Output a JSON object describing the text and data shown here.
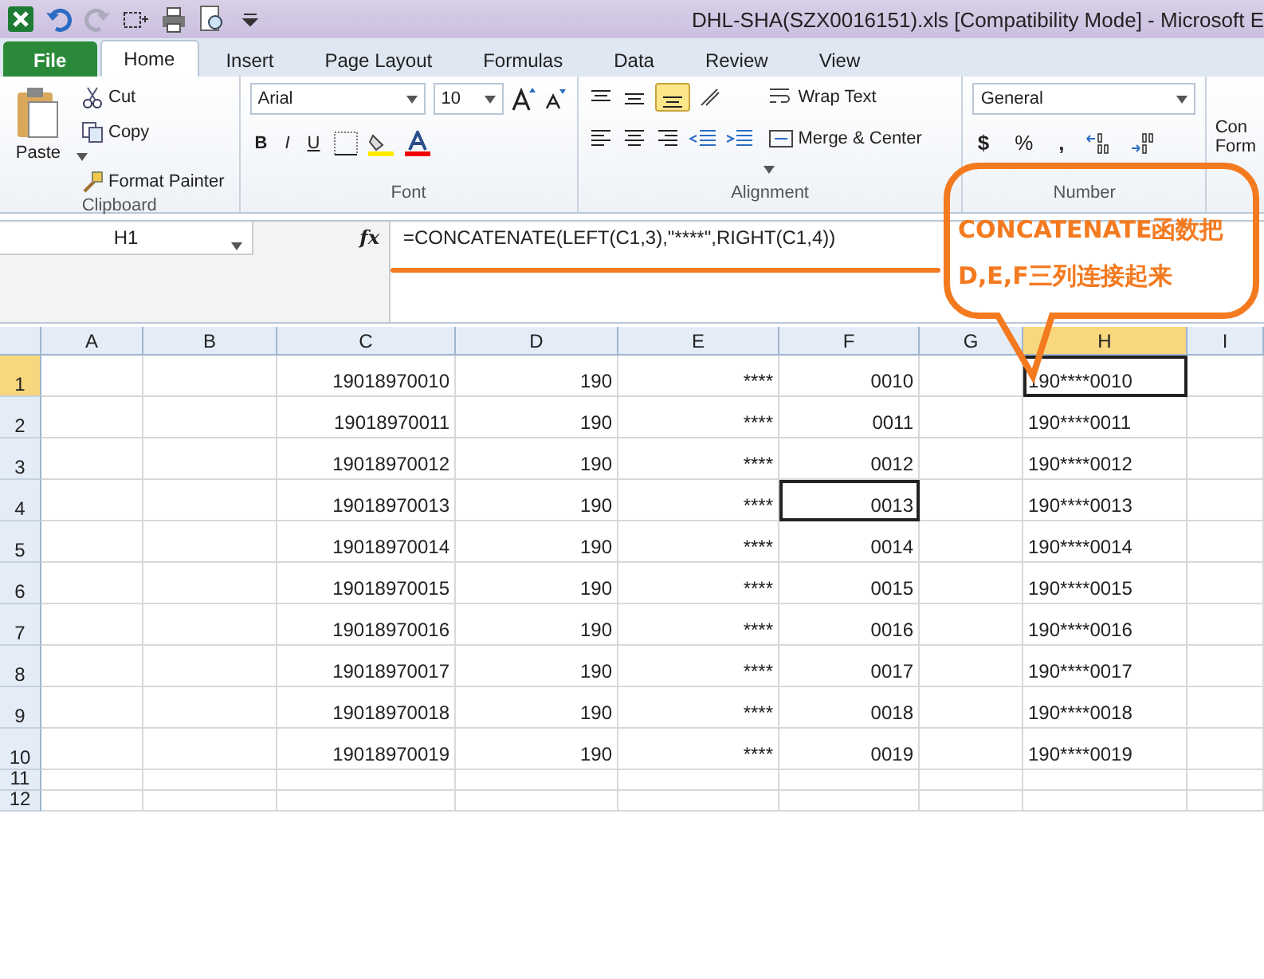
{
  "window": {
    "title": "DHL-SHA(SZX0016151).xls  [Compatibility Mode]  -  Microsoft E"
  },
  "tabs": [
    {
      "label": "File",
      "kind": "file",
      "selected": false
    },
    {
      "label": "Home",
      "kind": "tab",
      "selected": true
    },
    {
      "label": "Insert",
      "kind": "tab",
      "selected": false
    },
    {
      "label": "Page Layout",
      "kind": "tab",
      "selected": false
    },
    {
      "label": "Formulas",
      "kind": "tab",
      "selected": false
    },
    {
      "label": "Data",
      "kind": "tab",
      "selected": false
    },
    {
      "label": "Review",
      "kind": "tab",
      "selected": false
    },
    {
      "label": "View",
      "kind": "tab",
      "selected": false
    }
  ],
  "ribbon": {
    "clipboard": {
      "label": "Clipboard",
      "paste": "Paste",
      "cut": "Cut",
      "copy": "Copy",
      "format_painter": "Format Painter"
    },
    "font": {
      "label": "Font",
      "font_name": "Arial",
      "font_size": "10",
      "bold": "B",
      "italic": "I",
      "underline": "U"
    },
    "alignment": {
      "label": "Alignment",
      "wrap_text": "Wrap Text",
      "merge_center": "Merge & Center",
      "middle_align_on": true
    },
    "number": {
      "label": "Number",
      "format": "General",
      "currency": "$",
      "percent": "%",
      "comma": ","
    },
    "styles": {
      "conditional_formatting": "Con\nForm"
    }
  },
  "name_box": "H1",
  "fx": "fx",
  "formula": "=CONCATENATE(LEFT(C1,3),\"****\",RIGHT(C1,4))",
  "columns": [
    {
      "label": "A",
      "selected": false
    },
    {
      "label": "B",
      "selected": false
    },
    {
      "label": "C",
      "selected": false
    },
    {
      "label": "D",
      "selected": false
    },
    {
      "label": "E",
      "selected": false
    },
    {
      "label": "F",
      "selected": false
    },
    {
      "label": "G",
      "selected": false
    },
    {
      "label": "H",
      "selected": true
    },
    {
      "label": "I",
      "selected": false
    }
  ],
  "rows": [
    {
      "label": "1",
      "selected": true,
      "cells": [
        {},
        {},
        {
          "text": "19018970010",
          "kind": "number"
        },
        {
          "text": "190",
          "kind": "number"
        },
        {
          "text": "****",
          "kind": "number"
        },
        {
          "text": "0010",
          "kind": "number"
        },
        {},
        {
          "text": "190****0010",
          "kind": "text",
          "outlined": true
        },
        {}
      ]
    },
    {
      "label": "2",
      "selected": false,
      "cells": [
        {},
        {},
        {
          "text": "19018970011",
          "kind": "number"
        },
        {
          "text": "190",
          "kind": "number"
        },
        {
          "text": "****",
          "kind": "number"
        },
        {
          "text": "0011",
          "kind": "number"
        },
        {},
        {
          "text": "190****0011",
          "kind": "text"
        },
        {}
      ]
    },
    {
      "label": "3",
      "selected": false,
      "cells": [
        {},
        {},
        {
          "text": "19018970012",
          "kind": "number"
        },
        {
          "text": "190",
          "kind": "number"
        },
        {
          "text": "****",
          "kind": "number"
        },
        {
          "text": "0012",
          "kind": "number"
        },
        {},
        {
          "text": "190****0012",
          "kind": "text"
        },
        {}
      ]
    },
    {
      "label": "4",
      "selected": false,
      "cells": [
        {},
        {},
        {
          "text": "19018970013",
          "kind": "number"
        },
        {
          "text": "190",
          "kind": "number"
        },
        {
          "text": "****",
          "kind": "number"
        },
        {
          "text": "0013",
          "kind": "number",
          "outlined": true
        },
        {},
        {
          "text": "190****0013",
          "kind": "text"
        },
        {}
      ]
    },
    {
      "label": "5",
      "selected": false,
      "cells": [
        {},
        {},
        {
          "text": "19018970014",
          "kind": "number"
        },
        {
          "text": "190",
          "kind": "number"
        },
        {
          "text": "****",
          "kind": "number"
        },
        {
          "text": "0014",
          "kind": "number"
        },
        {},
        {
          "text": "190****0014",
          "kind": "text"
        },
        {}
      ]
    },
    {
      "label": "6",
      "selected": false,
      "cells": [
        {},
        {},
        {
          "text": "19018970015",
          "kind": "number"
        },
        {
          "text": "190",
          "kind": "number"
        },
        {
          "text": "****",
          "kind": "number"
        },
        {
          "text": "0015",
          "kind": "number"
        },
        {},
        {
          "text": "190****0015",
          "kind": "text"
        },
        {}
      ]
    },
    {
      "label": "7",
      "selected": false,
      "cells": [
        {},
        {},
        {
          "text": "19018970016",
          "kind": "number"
        },
        {
          "text": "190",
          "kind": "number"
        },
        {
          "text": "****",
          "kind": "number"
        },
        {
          "text": "0016",
          "kind": "number"
        },
        {},
        {
          "text": "190****0016",
          "kind": "text"
        },
        {}
      ]
    },
    {
      "label": "8",
      "selected": false,
      "cells": [
        {},
        {},
        {
          "text": "19018970017",
          "kind": "number"
        },
        {
          "text": "190",
          "kind": "number"
        },
        {
          "text": "****",
          "kind": "number"
        },
        {
          "text": "0017",
          "kind": "number"
        },
        {},
        {
          "text": "190****0017",
          "kind": "text"
        },
        {}
      ]
    },
    {
      "label": "9",
      "selected": false,
      "cells": [
        {},
        {},
        {
          "text": "19018970018",
          "kind": "number"
        },
        {
          "text": "190",
          "kind": "number"
        },
        {
          "text": "****",
          "kind": "number"
        },
        {
          "text": "0018",
          "kind": "number"
        },
        {},
        {
          "text": "190****0018",
          "kind": "text"
        },
        {}
      ]
    },
    {
      "label": "10",
      "selected": false,
      "cells": [
        {},
        {},
        {
          "text": "19018970019",
          "kind": "number"
        },
        {
          "text": "190",
          "kind": "number"
        },
        {
          "text": "****",
          "kind": "number"
        },
        {
          "text": "0019",
          "kind": "number"
        },
        {},
        {
          "text": "190****0019",
          "kind": "text"
        },
        {}
      ]
    },
    {
      "label": "11",
      "selected": false,
      "short": true,
      "cells": [
        {},
        {},
        {},
        {},
        {},
        {},
        {},
        {},
        {}
      ]
    },
    {
      "label": "12",
      "selected": false,
      "short": true,
      "cells": [
        {},
        {},
        {},
        {},
        {},
        {},
        {},
        {},
        {}
      ]
    }
  ],
  "callout": {
    "text": "CONCATENATE函数把D,E,F三列连接起来"
  }
}
